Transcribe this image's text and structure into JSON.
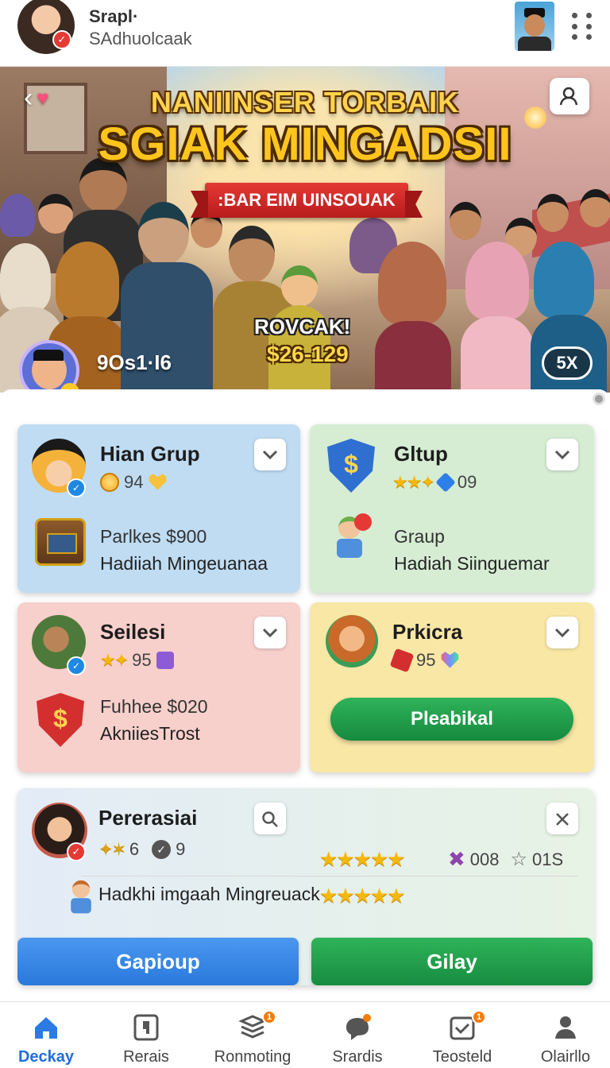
{
  "header": {
    "title": "Srapl·",
    "subtitle": "SAdhuolcaak"
  },
  "banner": {
    "title_line1": "NANIINSER TORBAIK",
    "title_line2": "SGIAK MINGADSII",
    "ribbon": ":BAR EIM UINSOUAK",
    "promo_line1": "ROVCAK!",
    "promo_line2": "$26-129",
    "count": "9Os1·I6",
    "pill": "5X"
  },
  "cards": [
    {
      "title": "Hian Grup",
      "stat": "94",
      "line1": "Parlkes $900",
      "line2": "Hadiiah Mingeuanaa",
      "bg": "#bfdcf3"
    },
    {
      "title": "Gltup",
      "stat": "09",
      "line1": "Graup",
      "line2": "Hadiah Siinguemar",
      "bg": "#d6edd4"
    },
    {
      "title": "Seilesi",
      "stat": "95",
      "line1": "Fuhhee $020",
      "line2": "AkniiesTrost",
      "bg": "#f7cfcb"
    },
    {
      "title": "Prkicra",
      "stat": "95",
      "button": "Pleabikal",
      "bg": "#f9e7a6"
    }
  ],
  "wide_card": {
    "title": "Pererasiai",
    "stat1": "6",
    "stat2": "9",
    "stat3": "008",
    "stat4": "01S",
    "line": "Hadkhi imgaah Mingreuack",
    "btn_left": "Gapioup",
    "btn_right": "Gilay"
  },
  "nav": [
    {
      "label": "Deckay",
      "active": true
    },
    {
      "label": "Rerais"
    },
    {
      "label": "Ronmoting",
      "badge": "1"
    },
    {
      "label": "Srardis"
    },
    {
      "label": "Teosteld",
      "badge": "1"
    },
    {
      "label": "Olairllo"
    }
  ],
  "colors": {
    "accent_blue": "#1e6fd9",
    "accent_green": "#1f9d4a",
    "badge_orange": "#f57c00"
  }
}
